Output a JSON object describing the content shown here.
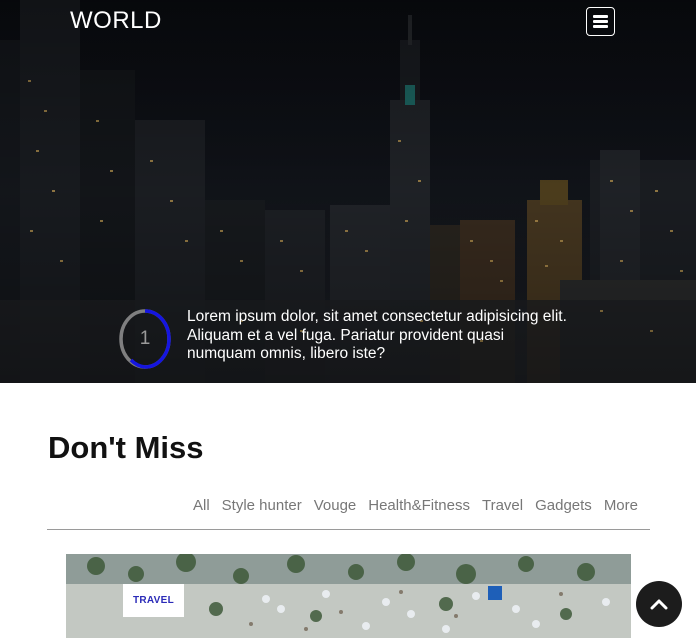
{
  "nav": {
    "brand": "WORLD",
    "menu_icon": "hamburger-menu-icon"
  },
  "hero": {
    "slide_number": "1",
    "caption": "Lorem ipsum dolor, sit amet consectetur adipisicing elit. Aliquam et a vel fuga. Pariatur provident quasi numquam omnis, libero iste?",
    "ring_color": "#1515e0"
  },
  "section": {
    "title": "Don't Miss",
    "filters": [
      "All",
      "Style hunter",
      "Vouge",
      "Health&Fitness",
      "Travel",
      "Gadgets",
      "More"
    ]
  },
  "card": {
    "tag": "TRAVEL",
    "tag_color": "#2b2bb8"
  },
  "scroll_top": {
    "icon": "chevron-up-icon"
  }
}
